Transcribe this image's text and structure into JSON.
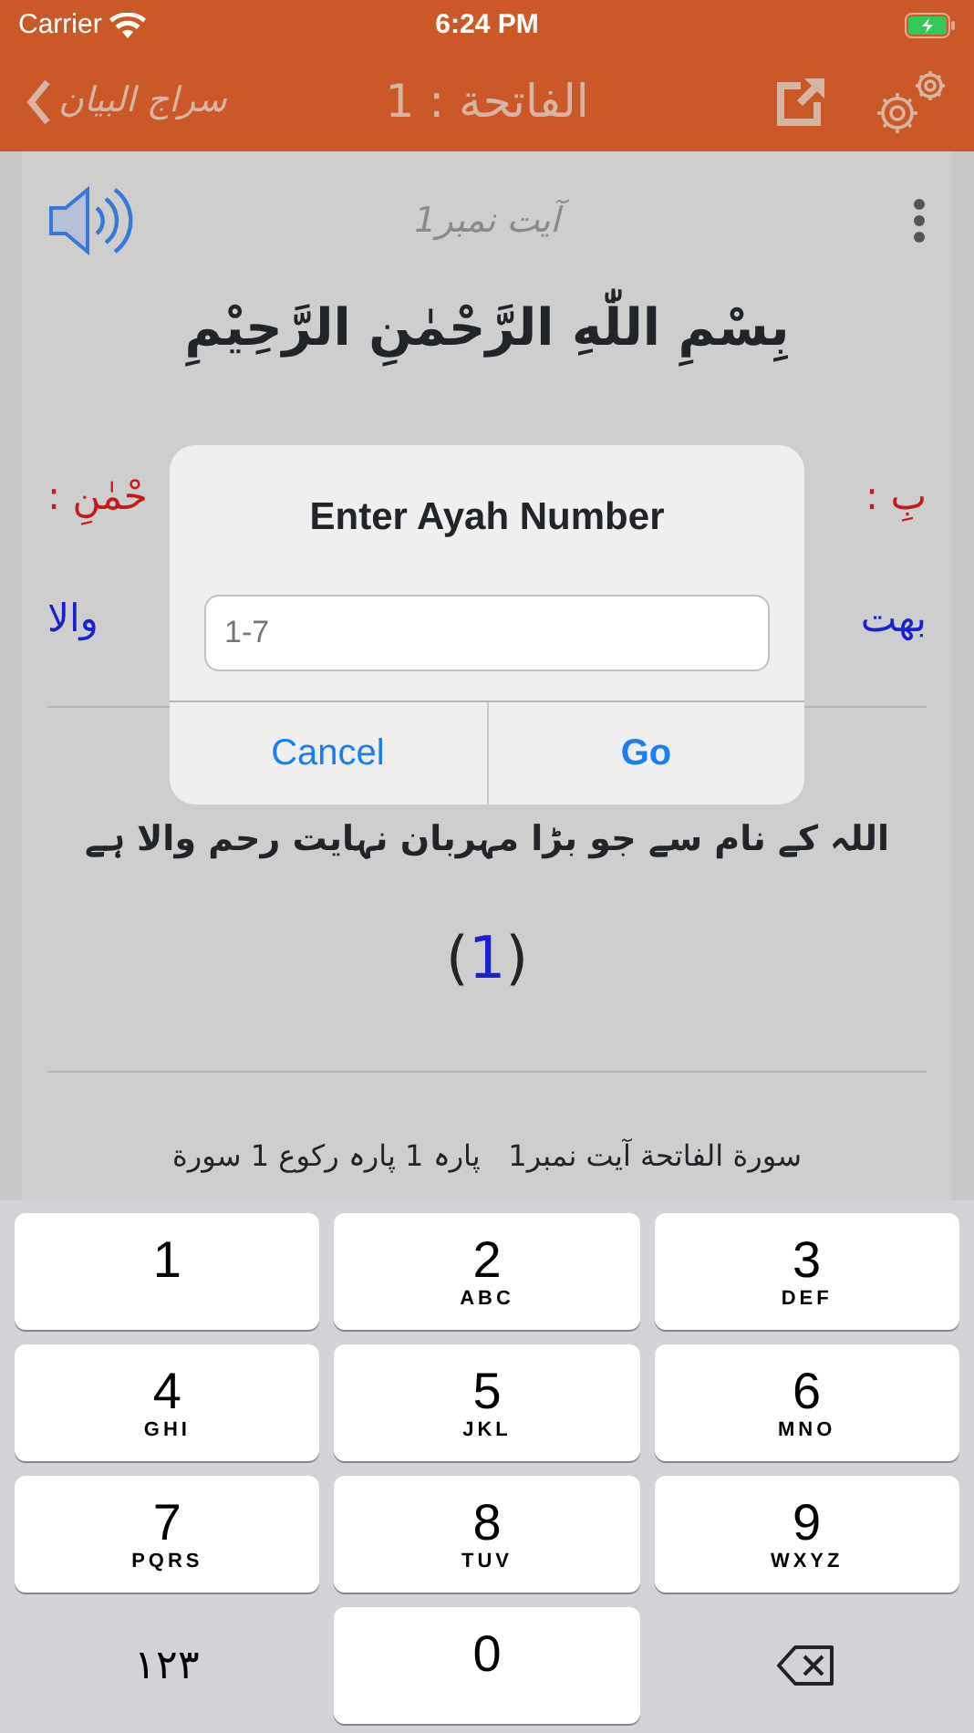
{
  "status_bar": {
    "carrier": "Carrier",
    "time": "6:24 PM"
  },
  "nav": {
    "back_label": "سراج البیان",
    "title": "الفاتحة : 1"
  },
  "ayah_header": "آیت نمبر1",
  "arabic_text": "بِسْمِ اللّٰهِ الرَّحْمٰنِ الرَّحِيْمِ",
  "word_meanings": [
    {
      "kind": "word",
      "right": "بِ :",
      "left": "حْمٰنِ :"
    },
    {
      "kind": "meaning",
      "right": "بهت",
      "left": "والا"
    }
  ],
  "translation": "اللہ کے نام سے جو بڑا مہربان نہایت رحم والا ہے",
  "ayah_marker": {
    "open": "(",
    "number": "1",
    "close": ")"
  },
  "footer": "سورة الفاتحة آیت نمبر1   پارہ 1 پارہ رکوع 1 سورة",
  "dialog": {
    "title": "Enter Ayah Number",
    "placeholder": "1-7",
    "buttons": [
      {
        "label": "Go",
        "kind": "default"
      },
      {
        "label": "Cancel",
        "kind": "cancel"
      }
    ]
  },
  "keyboard": [
    {
      "kind": "key",
      "digit": "3",
      "letters": "DEF"
    },
    {
      "kind": "key",
      "digit": "2",
      "letters": "ABC"
    },
    {
      "kind": "key",
      "digit": "1"
    },
    {
      "kind": "key",
      "digit": "6",
      "letters": "MNO"
    },
    {
      "kind": "key",
      "digit": "5",
      "letters": "JKL"
    },
    {
      "kind": "key",
      "digit": "4",
      "letters": "GHI"
    },
    {
      "kind": "key",
      "digit": "9",
      "letters": "WXYZ"
    },
    {
      "kind": "key",
      "digit": "8",
      "letters": "TUV"
    },
    {
      "kind": "key",
      "digit": "7",
      "letters": "PQRS"
    },
    {
      "kind": "delete"
    },
    {
      "kind": "key",
      "digit": "0"
    },
    {
      "kind": "mode",
      "digit": "١٢٣"
    }
  ]
}
